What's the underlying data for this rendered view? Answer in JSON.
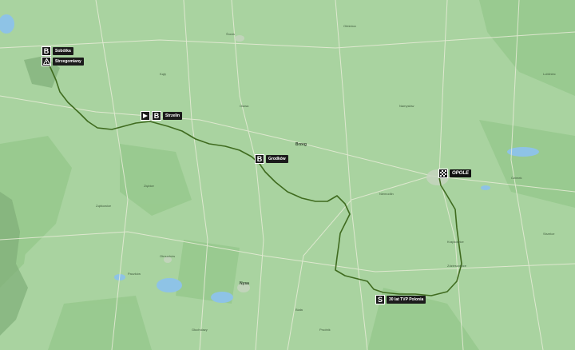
{
  "map": {
    "colors": {
      "land": "#a9d3a0",
      "forest": "#8fc585",
      "mountain": "#7fae78",
      "water": "#8ec3e6",
      "route": "#3f6b1f",
      "roads": "#e8ecd8",
      "urban": "#c7d5c0"
    }
  },
  "markers": {
    "kom1": {
      "icon": "B",
      "label": "Sobótka"
    },
    "sprint_hazard": {
      "icon": "warning-icon",
      "label": "Strzegomiany"
    },
    "start": {
      "icon": "B",
      "label": "Strzelin"
    },
    "kom2": {
      "icon": "B",
      "label": "Grodków"
    },
    "finish": {
      "icon": "finish-flag-icon",
      "label": "OPOLE"
    },
    "sprint": {
      "icon": "S",
      "label": "30 lat TVP Polonia"
    }
  },
  "towns": [
    "Środa",
    "Oleśnica",
    "Brzeg",
    "Nysa",
    "Otmuchów",
    "Paczków",
    "Głuchołazy",
    "Prudnik",
    "Biała",
    "Krapkowice",
    "Zdzieszowice",
    "Niemodlin",
    "Ząbkowice",
    "Ziębice",
    "Kąty",
    "Olawa",
    "Namysłów",
    "Ozimek",
    "Strzelce",
    "Lubliniec"
  ]
}
